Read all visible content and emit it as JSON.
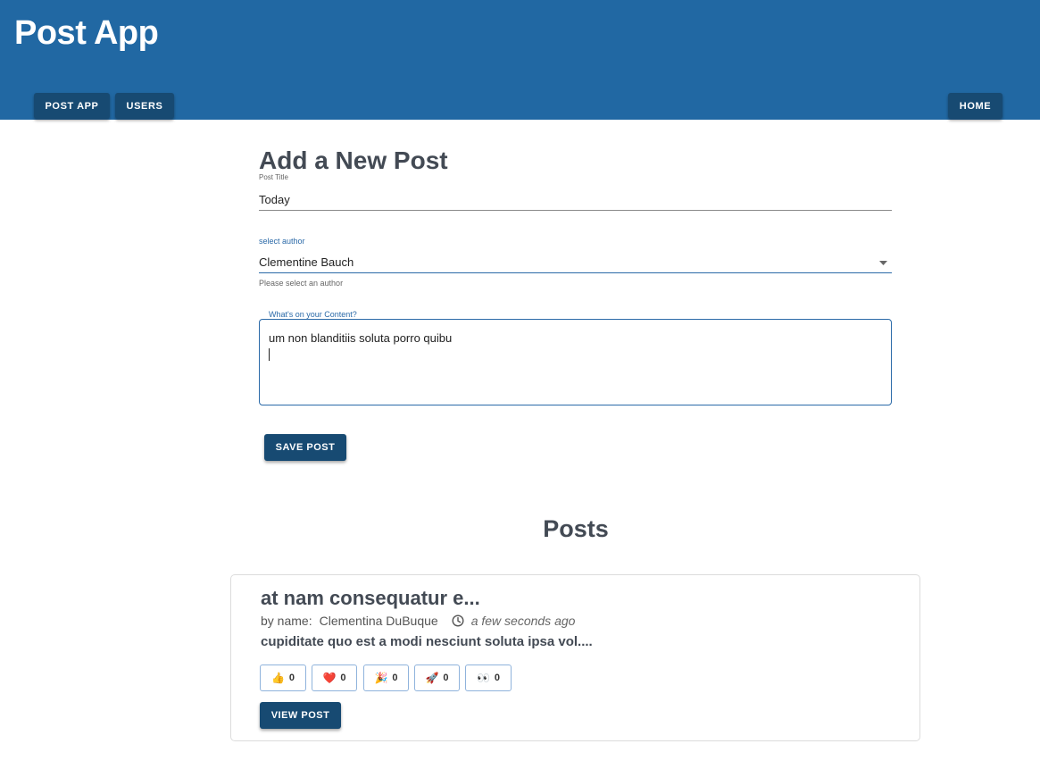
{
  "header": {
    "title": "Post App",
    "nav": {
      "post_app": "POST APP",
      "users": "USERS",
      "home": "HOME"
    }
  },
  "form": {
    "heading": "Add a New Post",
    "title_field": {
      "label": "Post Title",
      "value": "Today"
    },
    "author_select": {
      "label": "select author",
      "value": "Clementine Bauch",
      "helper": "Please select an author"
    },
    "content_field": {
      "label": "What's on your Content?",
      "value": "um non blanditiis soluta porro quibu"
    },
    "save_label": "SAVE POST"
  },
  "posts": {
    "heading": "Posts",
    "items": [
      {
        "title": "at nam consequatur e...",
        "author_prefix": "by name:",
        "author": "Clementina DuBuque",
        "time": "a few seconds ago",
        "excerpt": "cupiditate quo est a modi nesciunt soluta ipsa vol....",
        "reactions": [
          {
            "emoji": "👍",
            "count": "0",
            "icon": "thumbs-up-icon"
          },
          {
            "emoji": "❤️",
            "count": "0",
            "icon": "heart-icon"
          },
          {
            "emoji": "🎉",
            "count": "0",
            "icon": "party-icon"
          },
          {
            "emoji": "🚀",
            "count": "0",
            "icon": "rocket-icon"
          },
          {
            "emoji": "👀",
            "count": "0",
            "icon": "eyes-icon"
          }
        ],
        "view_label": "VIEW POST"
      }
    ]
  },
  "colors": {
    "header_bg": "#2168a3",
    "button_bg": "#174a72",
    "focus_accent": "#2b6aa8",
    "heading_text": "#434a54"
  }
}
